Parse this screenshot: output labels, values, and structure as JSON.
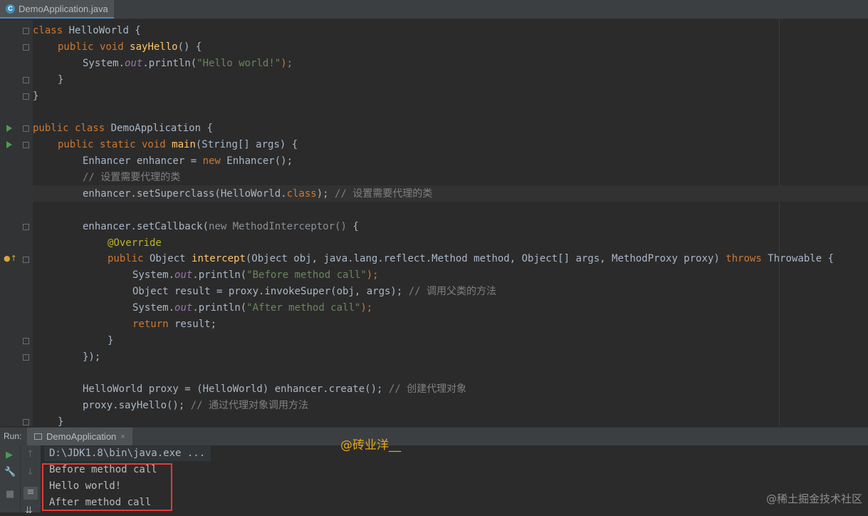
{
  "tab": {
    "filename": "DemoApplication.java",
    "close": "×",
    "icon_letter": "C"
  },
  "code": {
    "l1": {
      "kw": "class",
      "rest": " HelloWorld {"
    },
    "l2": {
      "kw": "public void",
      "fn": "sayHello",
      "rest": "() {"
    },
    "l3": {
      "a": "System.",
      "it": "out",
      "b": ".println(",
      "str": "\"Hello world!\"",
      "c": ");"
    },
    "l4": "}",
    "l5": "}",
    "l7": {
      "kw": "public class",
      "rest": " DemoApplication {"
    },
    "l8": {
      "kw": "public static void",
      "fn": "main",
      "rest": "(String[] args) {"
    },
    "l9": {
      "a": "Enhancer enhancer = ",
      "kw": "new",
      "b": " Enhancer();"
    },
    "l10": "// 设置需要代理的类",
    "l11": {
      "a": "enhancer.setSuperclass(HelloWorld.",
      "kw": "class",
      "b": ");",
      "cm": " // 设置需要代理的类"
    },
    "l13": {
      "a": "enhancer.setCallback(",
      "gr1": "new",
      "gr2": " MethodInterceptor()",
      "b": " {"
    },
    "l14": "@Override",
    "l15": {
      "kw": "public",
      "a": " Object ",
      "fn": "intercept",
      "b": "(Object obj, java.lang.reflect.Method method, Object[] args, MethodProxy proxy) ",
      "kw2": "throws",
      "c": " Throwable {"
    },
    "l16": {
      "a": "System.",
      "it": "out",
      "b": ".println(",
      "str": "\"Before method call\"",
      "c": ");"
    },
    "l17": {
      "a": "Object result = proxy.invokeSuper(obj, args);",
      "cm": " // 调用父类的方法"
    },
    "l18": {
      "a": "System.",
      "it": "out",
      "b": ".println(",
      "str": "\"After method call\"",
      "c": ");"
    },
    "l19": {
      "kw": "return",
      "a": " result;"
    },
    "l20": "}",
    "l21": "});",
    "l23": {
      "a": "HelloWorld proxy = (HelloWorld) enhancer.create();",
      "cm": " // 创建代理对象"
    },
    "l24": {
      "a": "proxy.sayHello();",
      "cm": " // 通过代理对象调用方法"
    },
    "l25": "}"
  },
  "run": {
    "label": "Run:",
    "tab": "DemoApplication",
    "close": "×",
    "cmd": "D:\\JDK1.8\\bin\\java.exe ...",
    "out1": "Before method call",
    "out2": "Hello world!",
    "out3": "After method call"
  },
  "watermark": {
    "author": "@砖业洋__",
    "site": "@稀土掘金技术社区"
  },
  "colors": {
    "keyword": "#cc7832",
    "function": "#ffc66d",
    "string": "#6a8759",
    "comment": "#808080",
    "annotation": "#bbb529",
    "field": "#9876aa",
    "highlight_box": "#e53935"
  }
}
